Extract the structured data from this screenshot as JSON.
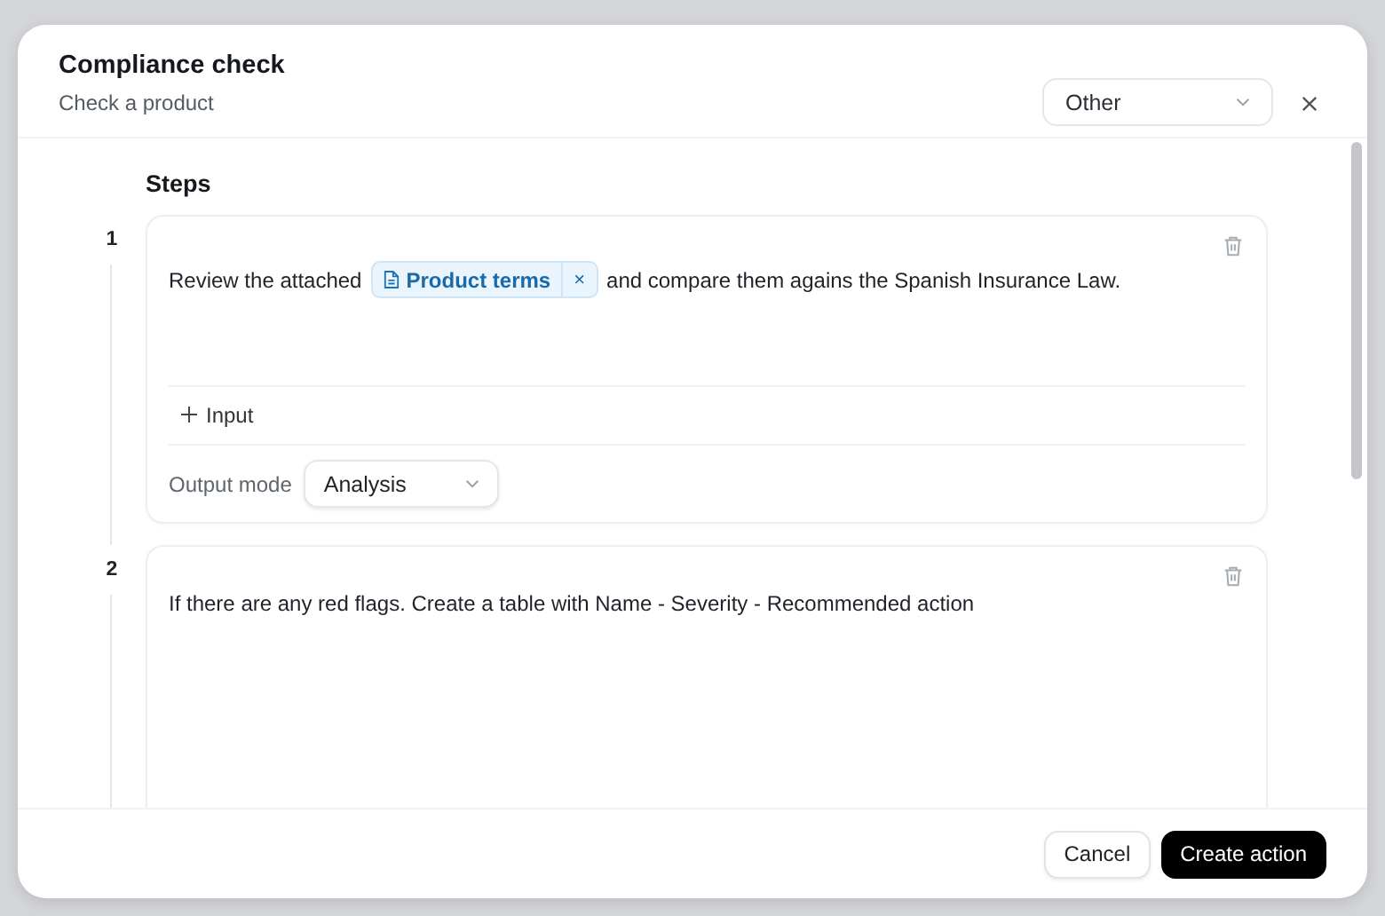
{
  "dialog": {
    "title": "Compliance check",
    "subtitle": "Check a product",
    "category": {
      "value": "Other"
    }
  },
  "steps_heading": "Steps",
  "steps": [
    {
      "number": "1",
      "segments": [
        {
          "kind": "text",
          "text": "Review the attached"
        },
        {
          "kind": "chip",
          "text": "Product terms",
          "remove": "×"
        },
        {
          "kind": "text",
          "text": "and compare them agains the Spanish Insurance Law."
        }
      ],
      "add_input": "Input",
      "output_label": "Output mode",
      "output_value": "Analysis"
    },
    {
      "number": "2",
      "segments": [
        {
          "kind": "text",
          "text": "If there are any red flags. Create a table with Name - Severity - Recommended action"
        }
      ]
    }
  ],
  "buttons": [
    {
      "label": "Cancel",
      "kind": "secondary"
    },
    {
      "label": "Create action",
      "kind": "primary"
    }
  ]
}
